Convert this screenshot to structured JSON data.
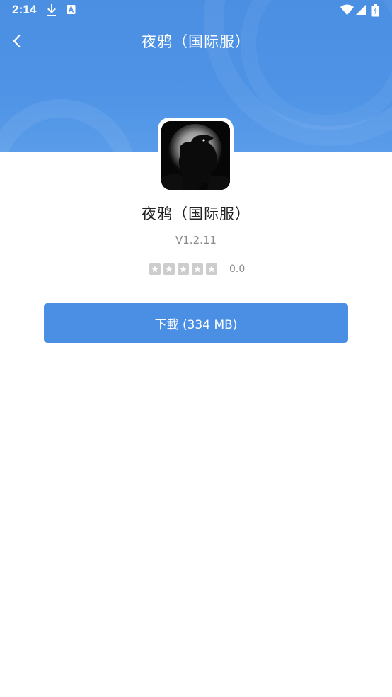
{
  "status_bar": {
    "time": "2:14",
    "icons": [
      "download-icon",
      "a-notification-icon",
      "wifi-icon",
      "signal-icon",
      "battery-icon"
    ]
  },
  "nav": {
    "back_icon": "back-arrow-icon",
    "title": "夜鸦（国际服）"
  },
  "app": {
    "icon": "raven-moon-icon",
    "name": "夜鸦（国际服）",
    "version": "V1.2.11",
    "rating": {
      "stars_total": 5,
      "stars_filled": 0,
      "value": "0.0"
    }
  },
  "actions": {
    "download_label": "下載 (334 MB)"
  },
  "colors": {
    "header_blue": "#4b8fe3",
    "button_blue": "#4a8fe3",
    "star_empty": "#cdcdcd",
    "text_gray": "#8a8a8a"
  }
}
